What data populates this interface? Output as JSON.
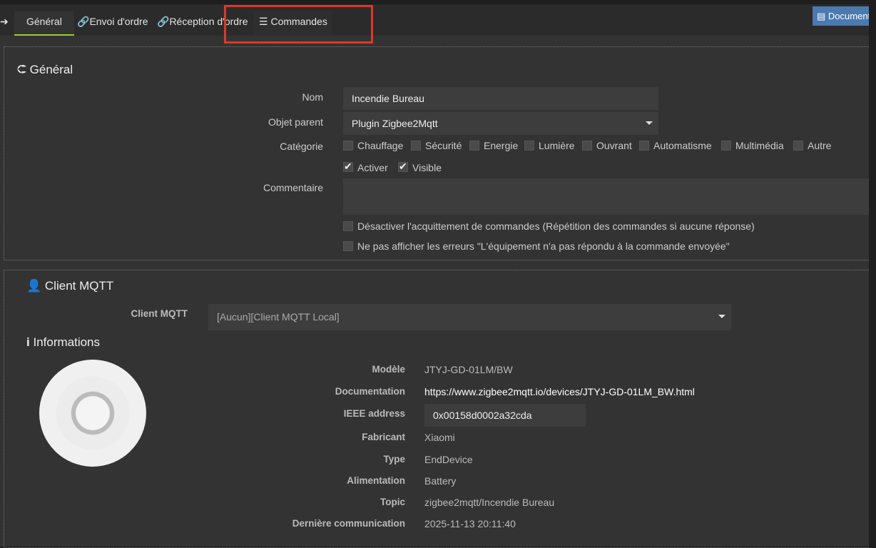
{
  "tabs": {
    "back_icon": "arrow-left-circle-icon",
    "items": [
      {
        "label": "Général",
        "active": true
      },
      {
        "label": "Envoi d'ordre",
        "icon": "link-icon"
      },
      {
        "label": "Réception d'ordre",
        "icon": "link-icon"
      },
      {
        "label": "Commandes",
        "icon": "list-icon"
      }
    ],
    "documentation_label": "Documentation"
  },
  "general": {
    "title": "Général",
    "nom_label": "Nom",
    "nom_value": "Incendie Bureau",
    "parent_label": "Objet parent",
    "parent_value": "Plugin Zigbee2Mqtt",
    "categorie_label": "Catégorie",
    "categories": [
      {
        "label": "Chauffage",
        "checked": false
      },
      {
        "label": "Sécurité",
        "checked": false
      },
      {
        "label": "Energie",
        "checked": false
      },
      {
        "label": "Lumière",
        "checked": false
      },
      {
        "label": "Ouvrant",
        "checked": false
      },
      {
        "label": "Automatisme",
        "checked": false
      },
      {
        "label": "Multimédia",
        "checked": false
      },
      {
        "label": "Autre",
        "checked": false
      }
    ],
    "activer_label": "Activer",
    "activer_checked": true,
    "visible_label": "Visible",
    "visible_checked": true,
    "commentaire_label": "Commentaire",
    "commentaire_value": "",
    "ack_label": "Désactiver l'acquittement de commandes (Répétition des commandes si aucune réponse)",
    "errors_label": "Ne pas afficher les erreurs \"L'équipement n'a pas répondu à la commande envoyée\""
  },
  "mqtt": {
    "title": "Client MQTT",
    "label": "Client MQTT",
    "value": "[Aucun][Client MQTT Local]"
  },
  "info": {
    "title": "Informations",
    "rows": [
      {
        "label": "Modèle",
        "value": "JTYJ-GD-01LM/BW"
      },
      {
        "label": "Documentation",
        "value": "https://www.zigbee2mqtt.io/devices/JTYJ-GD-01LM_BW.html"
      },
      {
        "label": "IEEE address",
        "value": "0x00158d0002a32cda"
      },
      {
        "label": "Fabricant",
        "value": "Xiaomi"
      },
      {
        "label": "Type",
        "value": "EndDevice"
      },
      {
        "label": "Alimentation",
        "value": "Battery"
      },
      {
        "label": "Topic",
        "value": "zigbee2mqtt/Incendie Bureau"
      },
      {
        "label": "Dernière communication",
        "value": "2025-11-13 20:11:40"
      }
    ]
  }
}
